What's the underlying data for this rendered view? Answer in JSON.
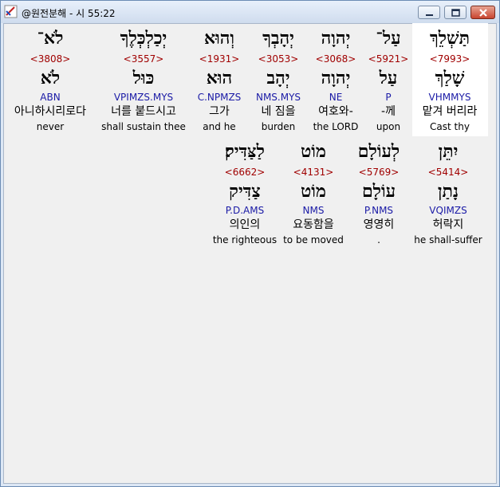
{
  "window": {
    "title": "@원전분해 - 시 55:22",
    "colors": {
      "strong": "#a00000",
      "morph": "#1a1aa6",
      "selected_bg": "#ffffff"
    }
  },
  "words": [
    {
      "heb": "תַּשְׁלֵךְ",
      "strong": "<7993>",
      "lemma": "שָׁלַךְ",
      "morph": "VHMMYS",
      "kor": "맡겨 버리라",
      "eng": "Cast thy"
    },
    {
      "heb": "עַל־",
      "strong": "<5921>",
      "lemma": "עַל",
      "morph": "P",
      "kor": "-께",
      "eng": "upon"
    },
    {
      "heb": "יְהוָה",
      "strong": "<3068>",
      "lemma": "יְהוָה",
      "morph": "NE",
      "kor": "여호와-",
      "eng": "the LORD"
    },
    {
      "heb": "יְהָבְךָ",
      "strong": "<3053>",
      "lemma": "יְהָב",
      "morph": "NMS.MYS",
      "kor": "네 짐을",
      "eng": "burden"
    },
    {
      "heb": "וְהוּא",
      "strong": "<1931>",
      "lemma": "הוּא",
      "morph": "C.NPMZS",
      "kor": "그가",
      "eng": "and he"
    },
    {
      "heb": "יְכַלְכְּלֶךָ",
      "strong": "<3557>",
      "lemma": "כּוּל",
      "morph": "VPIMZS.MYS",
      "kor": "너를 붙드시고",
      "eng": "shall sustain thee"
    },
    {
      "heb": "לֹא־",
      "strong": "<3808>",
      "lemma": "לֹא",
      "morph": "ABN",
      "kor": "아니하시리로다",
      "eng": "never"
    },
    {
      "heb": "יִתֵּן",
      "strong": "<5414>",
      "lemma": "נָתַן",
      "morph": "VQIMZS",
      "kor": "허락지",
      "eng": "he shall-suffer"
    },
    {
      "heb": "לְעוֹלָם",
      "strong": "<5769>",
      "lemma": "עוֹלָם",
      "morph": "P.NMS",
      "kor": "영영히",
      "eng": "."
    },
    {
      "heb": "מוֹט",
      "strong": "<4131>",
      "lemma": "מוֹט",
      "morph": "NMS",
      "kor": "요동함을",
      "eng": "to be moved"
    },
    {
      "heb": "לַצַּדִּיק׃",
      "strong": "<6662>",
      "lemma": "צַדִּיק",
      "morph": "P.D.AMS",
      "kor": "의인의",
      "eng": "the righteous"
    }
  ]
}
